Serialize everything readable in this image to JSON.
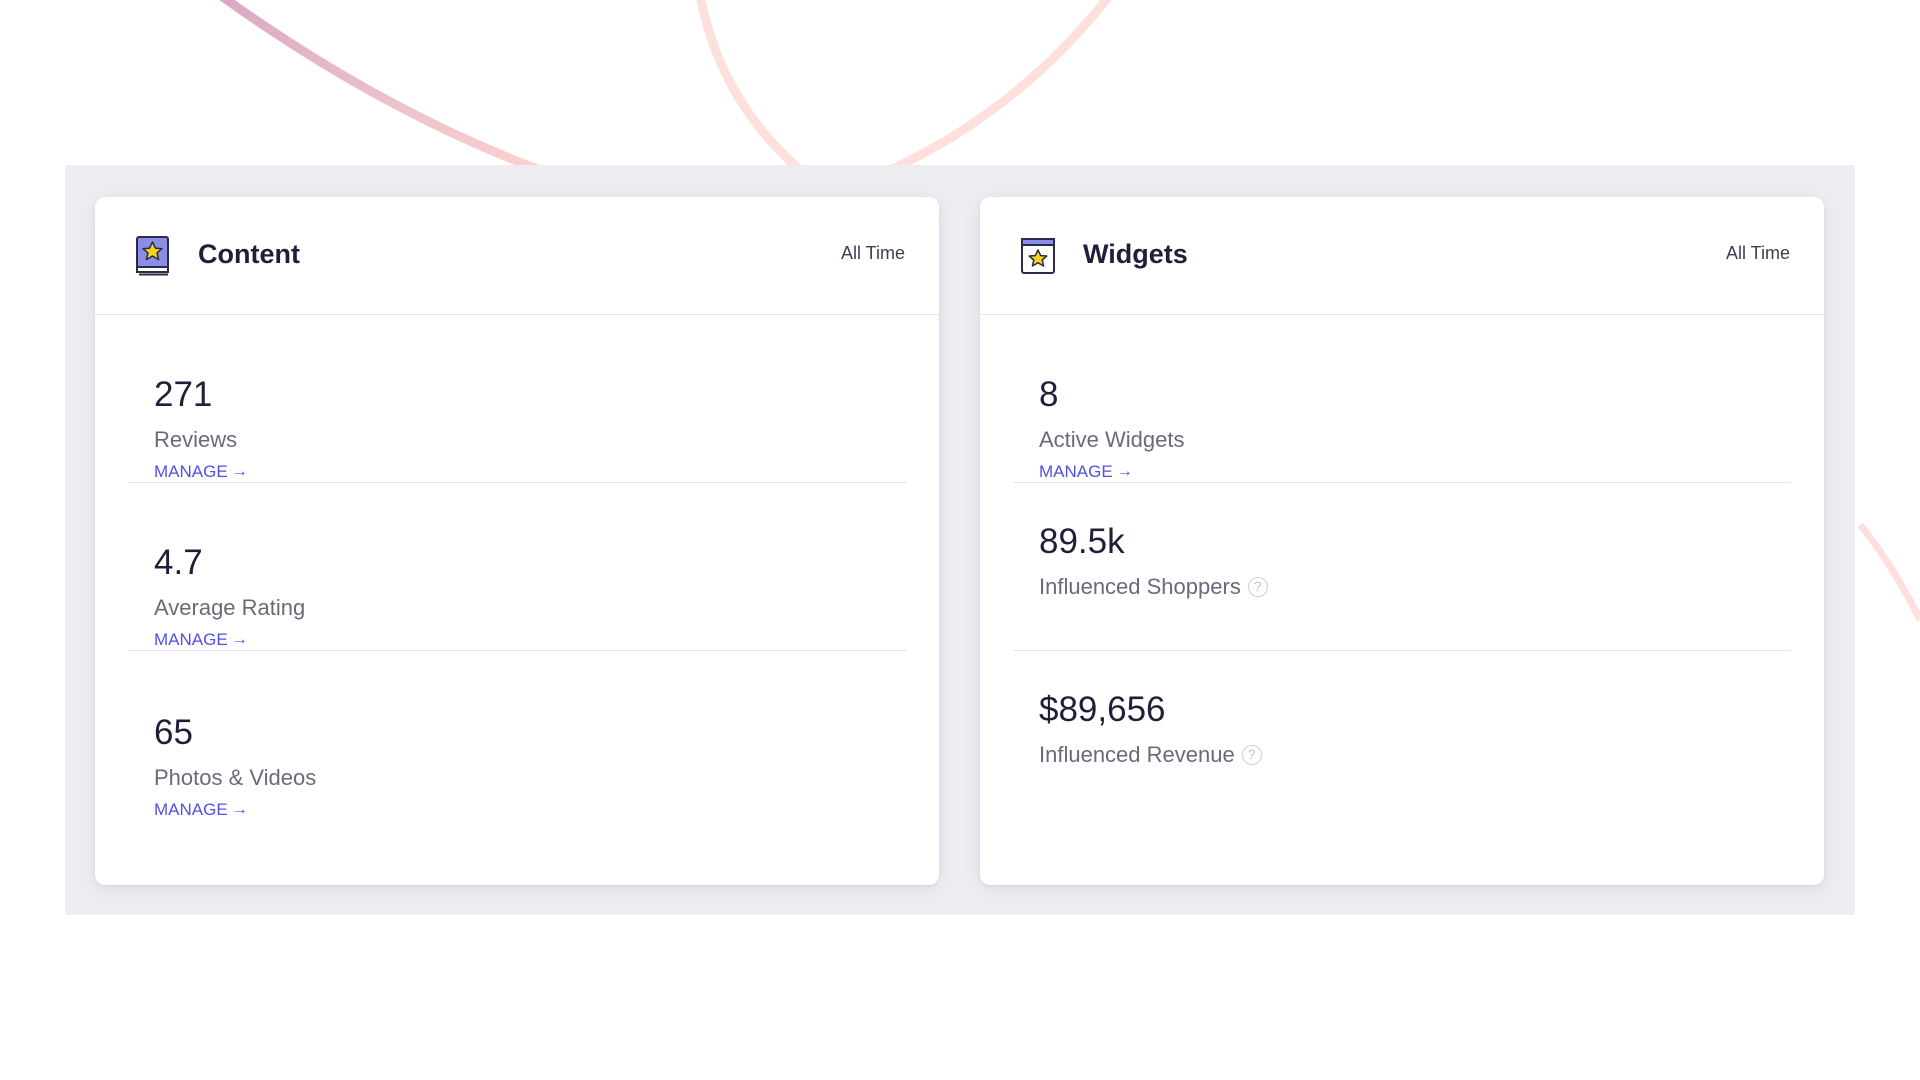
{
  "cards": {
    "content": {
      "title": "Content",
      "range": "All Time",
      "icon": "book-star-icon",
      "metrics": [
        {
          "value": "271",
          "label": "Reviews",
          "link": "MANAGE"
        },
        {
          "value": "4.7",
          "label": "Average Rating",
          "link": "MANAGE"
        },
        {
          "value": "65",
          "label": "Photos & Videos",
          "link": "MANAGE"
        }
      ]
    },
    "widgets": {
      "title": "Widgets",
      "range": "All Time",
      "icon": "window-star-icon",
      "metrics": [
        {
          "value": "8",
          "label": "Active Widgets",
          "link": "MANAGE"
        },
        {
          "value": "89.5k",
          "label": "Influenced Shoppers",
          "help_icon": "question-circle-icon"
        },
        {
          "value": "$89,656",
          "label": "Influenced Revenue",
          "help_icon": "question-circle-icon"
        }
      ]
    }
  },
  "colors": {
    "accent": "#5150e8",
    "title": "#1f1f3a",
    "label": "#6a6a7a",
    "panel_bg": "#eeeef2"
  }
}
